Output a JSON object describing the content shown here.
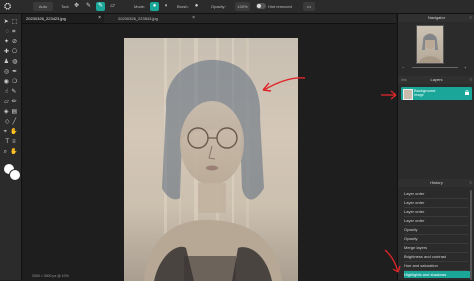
{
  "topbar": {
    "autosave": "Auto",
    "tool_label": "Tool:",
    "mode_label": "Mode:",
    "brush_label": "Brush:",
    "opacity_label": "Opacity:",
    "opacity_value": "100%",
    "hint_label": "Hint removed",
    "more": "•••"
  },
  "tabs": [
    {
      "label": "20230326_223423.jpg",
      "close": "×"
    },
    {
      "label": "20230326_223543.jpg",
      "close": "×"
    }
  ],
  "status": {
    "text": "2000 × 3000 px @ 10%"
  },
  "right": {
    "navigator_title": "Navigator",
    "navigator_side": "",
    "zoom_out": "−",
    "zoom_in": "+",
    "layers_title": "Layers",
    "layers_side": "Info",
    "layer": {
      "name": "Background",
      "sub": "Image"
    },
    "history_title": "History",
    "history_items": [
      "Layer order",
      "Layer order",
      "Layer order",
      "Layer order",
      "Opacity",
      "Opacity",
      "Merge layers",
      "Brightness and contrast",
      "Hue and saturation",
      "Highlights and shadows"
    ]
  },
  "colors": {
    "accent": "#1aa79a",
    "annotation": "#e0262b",
    "foreground": "#ffffff",
    "background_swatch": "#ffffff"
  }
}
